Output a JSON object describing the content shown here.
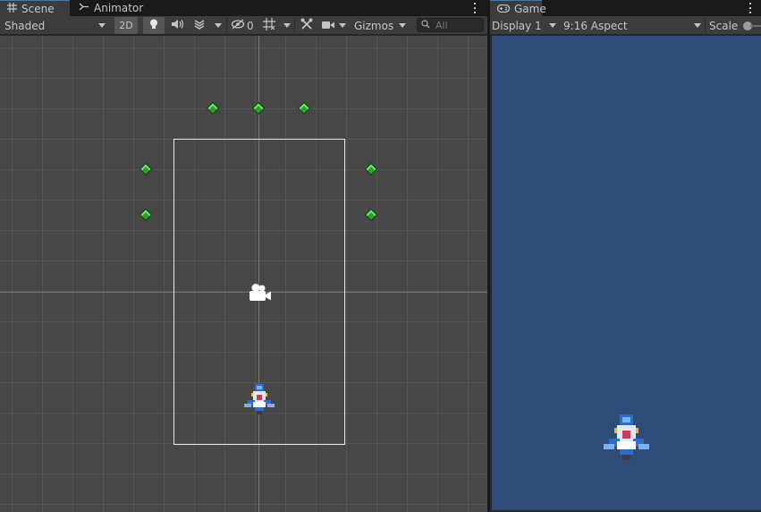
{
  "scene_window": {
    "tabs": [
      {
        "label": "Scene",
        "icon": "grid-icon",
        "active": true
      },
      {
        "label": "Animator",
        "icon": "animator-icon",
        "active": false
      }
    ],
    "toolbar": {
      "shading_mode": "Shaded",
      "mode_2d_label": "2D",
      "hidden_count": "0",
      "gizmos_label": "Gizmos",
      "search_placeholder": "All"
    }
  },
  "game_window": {
    "tab": {
      "label": "Game",
      "icon": "gamepad-icon"
    },
    "toolbar": {
      "display": "Display 1",
      "aspect": "9:16 Aspect",
      "scale_label": "Scale"
    }
  },
  "colors": {
    "game_background": "#2f4b77",
    "scene_background": "#474747",
    "tab_accent": "#3a79bb",
    "marker_green": "#2fa02f"
  }
}
